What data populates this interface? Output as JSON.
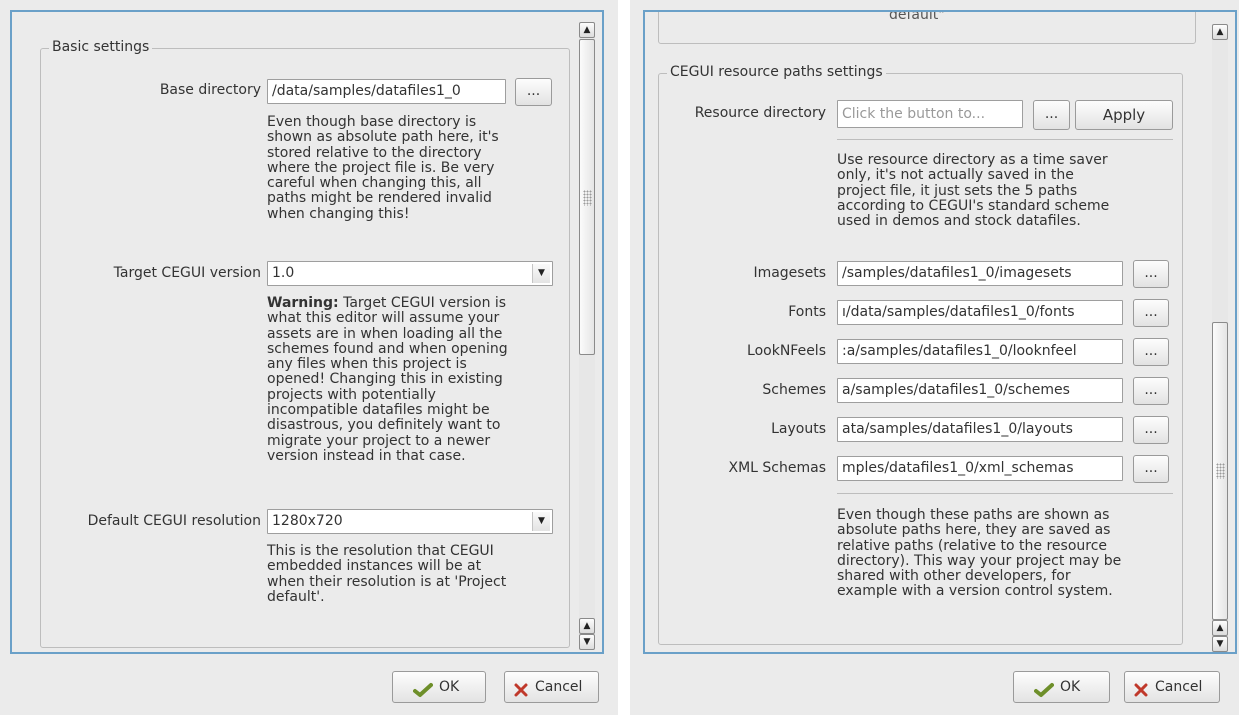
{
  "left": {
    "group_title": "Basic settings",
    "base_dir": {
      "label": "Base directory",
      "value": "/data/samples/datafiles1_0",
      "browse_label": "...",
      "help": [
        "Even though base directory is",
        "shown as absolute path here, it's",
        "stored relative to the directory",
        "where the project file is. Be very",
        "careful when changing this, all",
        "paths might be rendered invalid",
        "when changing this!"
      ]
    },
    "target_version": {
      "label": "Target CEGUI version",
      "value": "1.0",
      "warning_bold": "Warning:",
      "warning_rest": " Target CEGUI version is",
      "help": [
        "what this editor will assume your",
        "assets are in when loading all the",
        "schemes found and when opening",
        "any files when this project is",
        "opened! Changing this in existing",
        "projects with potentially",
        "incompatible datafiles might be",
        "disastrous, you definitely want to",
        "migrate your project to a newer",
        "version instead in that case."
      ]
    },
    "default_resolution": {
      "label": "Default CEGUI resolution",
      "value": "1280x720",
      "help": [
        "This is the resolution that CEGUI",
        "embedded instances will be at",
        "when their resolution is at 'Project",
        "default'."
      ]
    },
    "ok_label": "OK",
    "cancel_label": "Cancel"
  },
  "right": {
    "top_fragment": "default\"",
    "group_title": "CEGUI resource paths settings",
    "resource_dir": {
      "label": "Resource directory",
      "placeholder": "Click the button to...",
      "browse_label": "...",
      "apply_label": "Apply",
      "help": [
        "Use resource directory as a time saver",
        "only, it's not actually saved in the",
        "project file, it just sets the 5 paths",
        "according to CEGUI's standard scheme",
        "used in demos and stock datafiles."
      ]
    },
    "paths": [
      {
        "label": "Imagesets",
        "value": "/samples/datafiles1_0/imagesets",
        "browse_label": "..."
      },
      {
        "label": "Fonts",
        "value": "ı/data/samples/datafiles1_0/fonts",
        "browse_label": "..."
      },
      {
        "label": "LookNFeels",
        "value": ":a/samples/datafiles1_0/looknfeel",
        "browse_label": "..."
      },
      {
        "label": "Schemes",
        "value": "a/samples/datafiles1_0/schemes",
        "browse_label": "..."
      },
      {
        "label": "Layouts",
        "value": "ata/samples/datafiles1_0/layouts",
        "browse_label": "..."
      },
      {
        "label": "XML Schemas",
        "value": "mples/datafiles1_0/xml_schemas",
        "browse_label": "..."
      }
    ],
    "bottom_help": [
      "Even though these paths are shown as",
      "absolute paths here, they are saved as",
      "relative paths (relative to the resource",
      "directory). This way your project may be",
      "shared with other developers, for",
      "example with a version control system."
    ],
    "ok_label": "OK",
    "cancel_label": "Cancel"
  }
}
